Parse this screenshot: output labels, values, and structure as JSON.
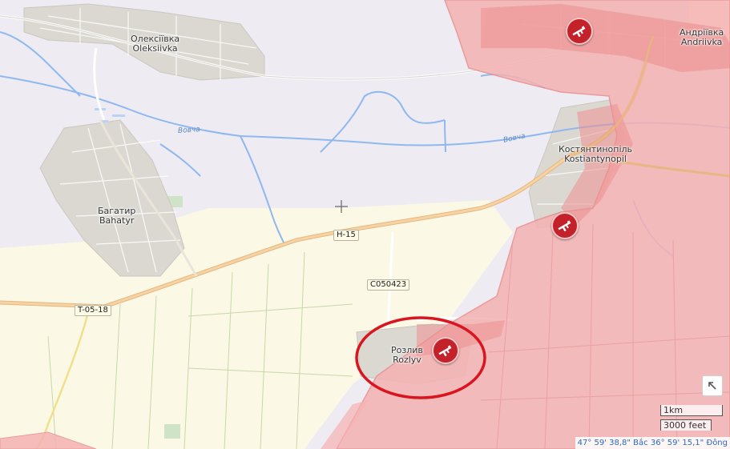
{
  "map": {
    "settlements": [
      {
        "id": "oleksiivka",
        "cyrillic": "Олексіївка",
        "latin": "Oleksiivka"
      },
      {
        "id": "andriivka",
        "cyrillic": "Андріївка",
        "latin": "Andriivka"
      },
      {
        "id": "kostiantynopil",
        "cyrillic": "Костянтинопіль",
        "latin": "Kostiantynopil"
      },
      {
        "id": "bahatyr",
        "cyrillic": "Багатир",
        "latin": "Bahatyr"
      },
      {
        "id": "rozlyv",
        "cyrillic": "Розлив",
        "latin": "Rozlyv"
      }
    ],
    "roads": {
      "h15": "H-15",
      "t0518": "T-05-18",
      "c050423": "C050423"
    },
    "rivers": {
      "vovcha_west": "Вовча",
      "vovcha_east": "Вовча"
    },
    "colors": {
      "occupied_zone": "#f5b2b2",
      "occupied_border": "#e98e8e",
      "marker": "#c4222a",
      "highlight_circle": "#d9151f",
      "river": "#8fb8f0",
      "main_road": "#f2c28a"
    },
    "markers": [
      {
        "icon": "rifle-icon",
        "location": "Андріївка"
      },
      {
        "icon": "rifle-icon",
        "location": "Костянтинопіль"
      },
      {
        "icon": "rifle-icon",
        "location": "Розлив"
      }
    ]
  },
  "controls": {
    "zoom_icon": "expand-arrow-icon",
    "scale_km": "1km",
    "scale_ft": "3000 feet",
    "coordinates": "47° 59' 38,8\" Bắc 36° 59' 15,1\" Đông"
  }
}
